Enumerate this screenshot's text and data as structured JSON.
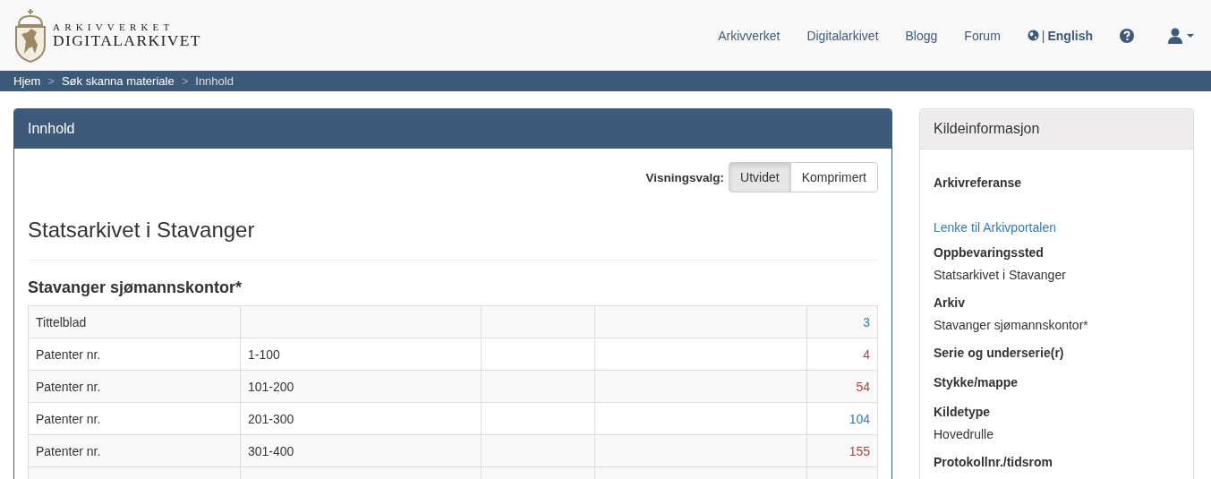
{
  "logo": {
    "top_line": "ARKIVVERKET",
    "bottom_line": "DIGITALARKIVET"
  },
  "nav": [
    {
      "kind": "link",
      "label": "Arkivverket"
    },
    {
      "kind": "link",
      "label": "Digitalarkivet"
    },
    {
      "kind": "link",
      "label": "Blogg"
    },
    {
      "kind": "link",
      "label": "Forum"
    },
    {
      "kind": "language",
      "separator": "|",
      "label": "English"
    },
    {
      "kind": "help"
    },
    {
      "kind": "user"
    }
  ],
  "breadcrumb": {
    "separators": [
      ">",
      ">"
    ],
    "items": [
      "Hjem",
      "Søk skanna materiale",
      "Innhold"
    ]
  },
  "panel": {
    "title": "Innhold",
    "view_label": "Visningsvalg:",
    "view_options": [
      {
        "label": "Utvidet",
        "selected": true
      },
      {
        "label": "Komprimert",
        "selected": false
      }
    ],
    "heading": "Statsarkivet i Stavanger",
    "subheading": "Stavanger sjømannskontor*",
    "rows": [
      {
        "cells": [
          "Tittelblad",
          "",
          "",
          ""
        ],
        "page": "3",
        "color": "#337ab7"
      },
      {
        "cells": [
          "Patenter nr.",
          "1-100",
          "",
          ""
        ],
        "page": "4",
        "color": "#a94442"
      },
      {
        "cells": [
          "Patenter nr.",
          "101-200",
          "",
          ""
        ],
        "page": "54",
        "color": "#a94442"
      },
      {
        "cells": [
          "Patenter nr.",
          "201-300",
          "",
          ""
        ],
        "page": "104",
        "color": "#337ab7"
      },
      {
        "cells": [
          "Patenter nr.",
          "301-400",
          "",
          ""
        ],
        "page": "155",
        "color": "#a94442"
      }
    ]
  },
  "sidebar": {
    "title": "Kildeinformasjon",
    "items": [
      {
        "kind": "heading",
        "text": "Arkivreferanse"
      },
      {
        "kind": "link",
        "text": "Lenke til Arkivportalen"
      },
      {
        "kind": "heading",
        "text": "Oppbevaringssted"
      },
      {
        "kind": "value",
        "text": "Statsarkivet i Stavanger"
      },
      {
        "kind": "heading",
        "text": "Arkiv"
      },
      {
        "kind": "value",
        "text": "Stavanger sjømannskontor*"
      },
      {
        "kind": "heading",
        "text": "Serie og underserie(r)"
      },
      {
        "kind": "heading",
        "text": "Stykke/mappe"
      },
      {
        "kind": "heading",
        "text": "Kildetype"
      },
      {
        "kind": "value",
        "text": "Hovedrulle"
      },
      {
        "kind": "heading",
        "text": "Protokollnr./tidsrom"
      }
    ]
  }
}
